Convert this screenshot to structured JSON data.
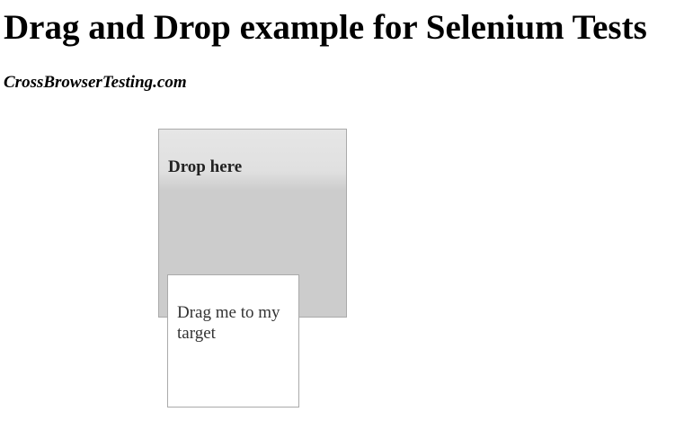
{
  "page": {
    "title": "Drag and Drop example for Selenium Tests",
    "subtitle": "CrossBrowserTesting.com"
  },
  "drop_target": {
    "label": "Drop here"
  },
  "draggable": {
    "label": "Drag me to my target"
  },
  "colors": {
    "text": "#000000",
    "drop_target_background": "#cccccc",
    "drop_target_top": "#e6e6e6",
    "border": "#aaaaaa",
    "draggable_background": "#ffffff"
  }
}
